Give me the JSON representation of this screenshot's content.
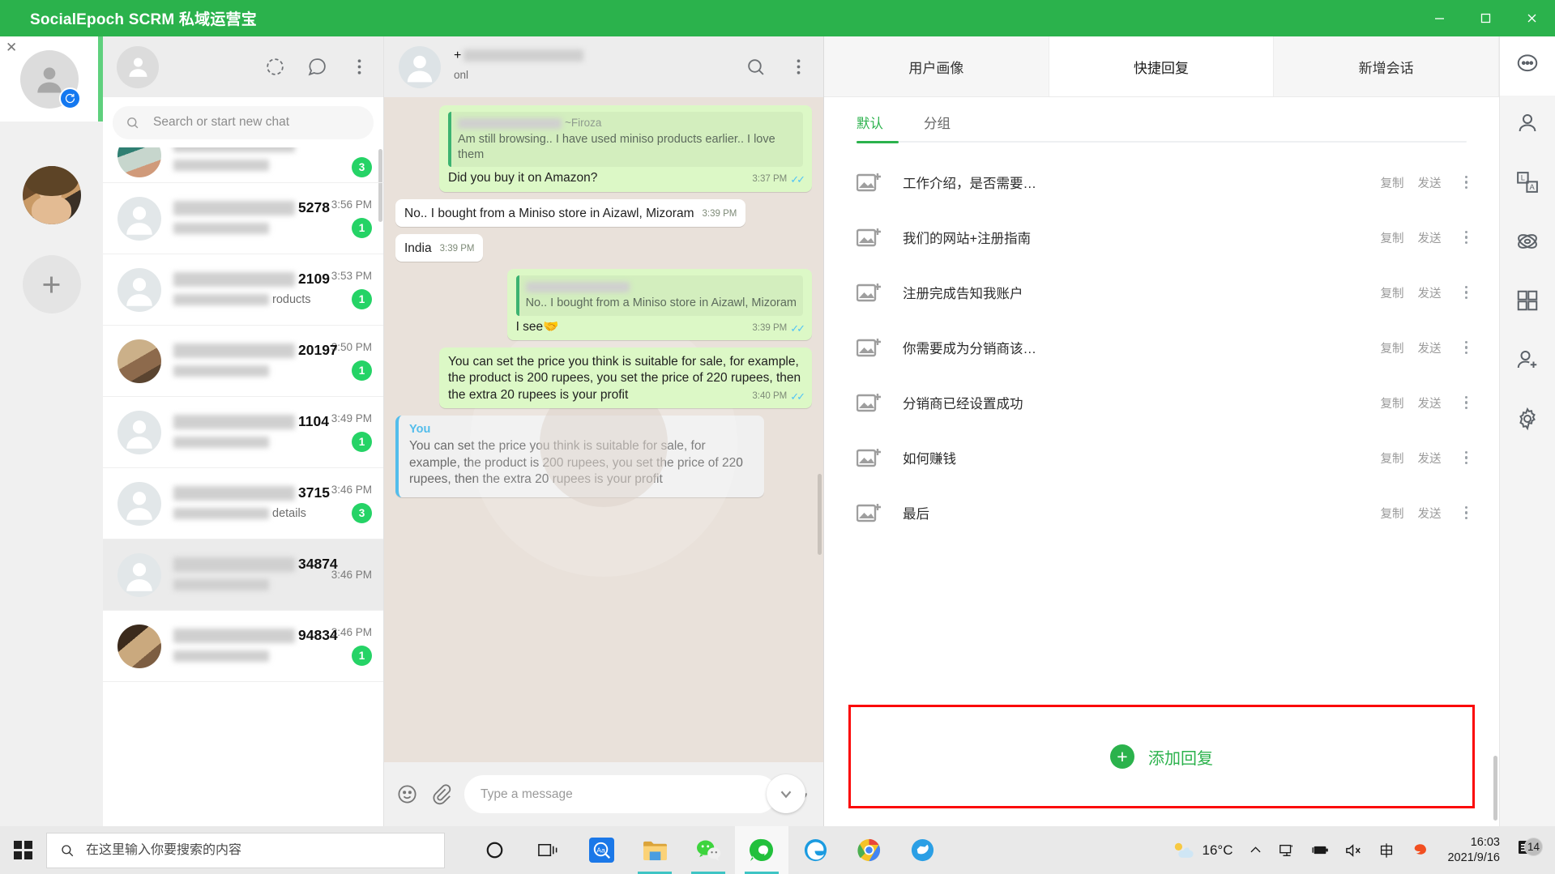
{
  "window": {
    "title": "SocialEpoch SCRM 私域运营宝",
    "controls": {
      "minimize": "—",
      "maximize": "▢",
      "close": "✕"
    }
  },
  "account_rail": {
    "close_label": "✕",
    "add_label": "+",
    "accounts": [
      {
        "name": "account-placeholder",
        "badge": "sync-icon"
      },
      {
        "name": "account-photo"
      }
    ]
  },
  "chat_list": {
    "search": {
      "placeholder": "Search or start new chat",
      "value": ""
    },
    "header_icons": [
      "status-ring-icon",
      "new-chat-icon",
      "menu-icon"
    ],
    "rows": [
      {
        "name": "",
        "preview": "",
        "time": "",
        "badge": "3",
        "avatar": "ph1",
        "partial": true
      },
      {
        "name": "5278",
        "preview": "",
        "time": "3:56 PM",
        "badge": "1",
        "avatar": "blank"
      },
      {
        "name": "2109",
        "preview": "roducts",
        "time": "3:53 PM",
        "badge": "1",
        "avatar": "blank"
      },
      {
        "name": "20197",
        "preview": "",
        "time": "3:50 PM",
        "badge": "1",
        "avatar": "ph2"
      },
      {
        "name": "1104",
        "preview": "",
        "time": "3:49 PM",
        "badge": "1",
        "avatar": "blank"
      },
      {
        "name": "3715",
        "preview": "details",
        "time": "3:46 PM",
        "badge": "3",
        "avatar": "blank"
      },
      {
        "name": "34874",
        "preview": "",
        "time": "3:46 PM",
        "badge": "",
        "avatar": "blank",
        "selected": true
      },
      {
        "name": "94834",
        "preview": "",
        "time": "3:46 PM",
        "badge": "1",
        "avatar": "ph3"
      }
    ]
  },
  "conversation": {
    "contact_number": "+",
    "status": "onl",
    "header_icons": [
      "search-icon",
      "menu-icon"
    ],
    "messages": [
      {
        "direction": "out",
        "quote": {
          "author": "~Firoza",
          "text": "Am still browsing.. I have used miniso products earlier.. I love them"
        },
        "text": "Did you buy it on Amazon?",
        "time": "3:37 PM",
        "ticks": true
      },
      {
        "direction": "in",
        "text": "No.. I bought from a Miniso store in Aizawl, Mizoram",
        "time": "3:39 PM",
        "ticks": false
      },
      {
        "direction": "in",
        "text": "India",
        "time": "3:39 PM",
        "ticks": false,
        "inline": true
      },
      {
        "direction": "out",
        "quote": {
          "author": "",
          "text": "No.. I bought from a Miniso store in Aizawl, Mizoram"
        },
        "text": "I see🤝",
        "time": "3:39 PM",
        "ticks": true
      },
      {
        "direction": "out",
        "text": "You can set the price you think is suitable for sale, for example, the product is 200 rupees, you set the price of 220 rupees, then the extra 20 rupees is your profit",
        "time": "3:40 PM",
        "ticks": true
      }
    ],
    "pinned_card": {
      "author": "You",
      "text": "You can set the price you think is suitable for sale, for example, the product is 200 rupees, you set the price of 220 rupees, then the extra 20 rupees is your profit"
    },
    "composer": {
      "placeholder": "Type a message",
      "value": "",
      "icons": [
        "emoji-icon",
        "attach-icon",
        "microphone-icon"
      ]
    }
  },
  "crm_panel": {
    "tabs": [
      {
        "label": "用户画像",
        "active": false
      },
      {
        "label": "快捷回复",
        "active": true
      },
      {
        "label": "新增会话",
        "active": false
      }
    ],
    "sub_tabs": [
      {
        "label": "默认",
        "active": true
      },
      {
        "label": "分组",
        "active": false
      }
    ],
    "action_copy": "复制",
    "action_send": "发送",
    "replies": [
      {
        "text": "工作介绍，是否需要…"
      },
      {
        "text": "我们的网站+注册指南"
      },
      {
        "text": "注册完成告知我账户"
      },
      {
        "text": "你需要成为分销商该…"
      },
      {
        "text": "分销商已经设置成功"
      },
      {
        "text": "如何赚钱"
      },
      {
        "text": "最后"
      }
    ],
    "add_button": {
      "label": "添加回复",
      "icon": "plus-icon",
      "highlight_color": "#fb0707"
    }
  },
  "icon_rail": [
    {
      "name": "chat-bubble-icon",
      "active": true
    },
    {
      "name": "person-icon",
      "active": false
    },
    {
      "name": "translate-icon",
      "active": false
    },
    {
      "name": "atom-icon",
      "active": false
    },
    {
      "name": "grid-icon",
      "active": false
    },
    {
      "name": "add-person-icon",
      "active": false
    },
    {
      "name": "gear-icon",
      "active": false
    }
  ],
  "taskbar": {
    "search": {
      "placeholder": "在这里输入你要搜索的内容",
      "value": ""
    },
    "apps": [
      {
        "name": "cortana-icon"
      },
      {
        "name": "task-view-icon"
      },
      {
        "name": "translator-icon"
      },
      {
        "name": "file-explorer-icon"
      },
      {
        "name": "wechat-icon"
      },
      {
        "name": "socialepoch-icon"
      },
      {
        "name": "edge-icon"
      },
      {
        "name": "chrome-icon"
      },
      {
        "name": "bird-app-icon"
      }
    ],
    "tray": {
      "temperature": "16°C",
      "chevron": "⌃",
      "network": "network-icon",
      "battery": "battery-icon",
      "volume": "volume-muted-icon",
      "ime": "中",
      "sogou": "sogou-icon"
    },
    "clock": {
      "time": "16:03",
      "date": "2021/9/16"
    },
    "notifications": {
      "count": "14"
    }
  },
  "colors": {
    "brand_green": "#2bb24c",
    "bubble_out": "#dcf8c6",
    "badge_green": "#25d366",
    "highlight_red": "#fb0707",
    "accent_blue": "#53bdeb"
  }
}
